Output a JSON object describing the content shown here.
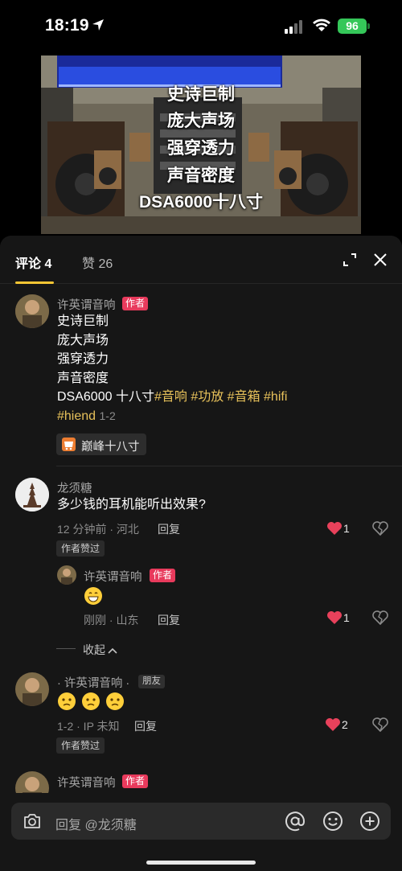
{
  "status_bar": {
    "time": "18:19",
    "battery": "96",
    "icons": [
      "location-arrow-icon",
      "signal-icon",
      "wifi-icon",
      "battery-icon"
    ]
  },
  "video": {
    "overlay_lines": [
      "史诗巨制",
      "庞大声场",
      "强穿透力",
      "声音密度",
      "DSA6000十八寸"
    ]
  },
  "tabs": {
    "comments": "评论 4",
    "likes": "赞 26",
    "accent": "#f7c634"
  },
  "comments": [
    {
      "author": "许英谓音响",
      "author_tag": "作者",
      "lines": [
        "史诗巨制",
        "庞大声场",
        "强穿透力",
        "声音密度"
      ],
      "last_line_prefix": "DSA6000 十八寸",
      "hashtags": [
        "#音响",
        "#功放",
        "#音箱",
        "#hifi"
      ],
      "hashtag_wrap": "#hiend",
      "date": "1-2",
      "product": "巅峰十八寸"
    },
    {
      "author": "龙须糖",
      "text": "多少钱的耳机能听出效果?",
      "meta": "12 分钟前 · 河北",
      "reply_label": "回复",
      "likes": "1",
      "badge": "作者赞过",
      "reply": {
        "author": "许英谓音响",
        "author_tag": "作者",
        "meta": "刚刚 · 山东",
        "reply_label": "回复",
        "likes": "1"
      },
      "collapse_label": "收起"
    },
    {
      "author": "· 许英谓音响 ·",
      "author_tag": "朋友",
      "meta": "1-2 · IP 未知",
      "reply_label": "回复",
      "likes": "2",
      "badge": "作者赞过"
    },
    {
      "author": "许英谓音响",
      "author_tag": "作者"
    }
  ],
  "input": {
    "placeholder": "回复 @龙须糖"
  },
  "colors": {
    "like_red": "#e8415b",
    "author_tag": "#e83a5c",
    "hashtag": "#e7c15a",
    "battery": "#35c759"
  }
}
